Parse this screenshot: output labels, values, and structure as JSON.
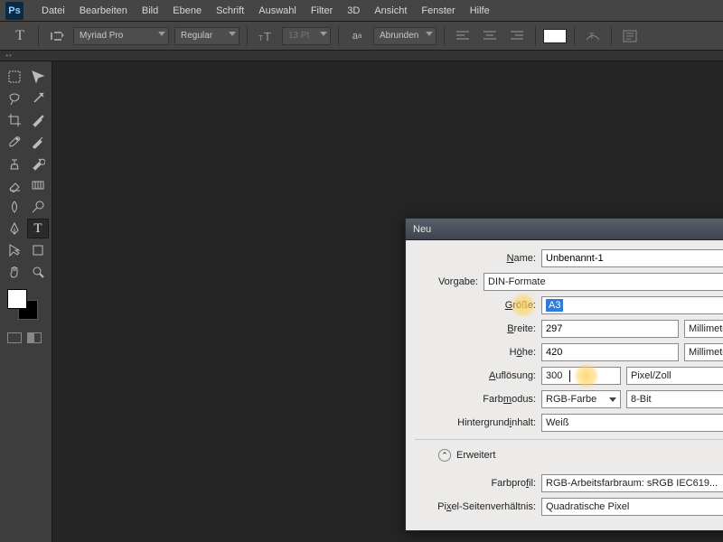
{
  "app": {
    "logo": "Ps"
  },
  "menu": [
    "Datei",
    "Bearbeiten",
    "Bild",
    "Ebene",
    "Schrift",
    "Auswahl",
    "Filter",
    "3D",
    "Ansicht",
    "Fenster",
    "Hilfe"
  ],
  "options": {
    "font": "Myriad Pro",
    "style": "Regular",
    "size": "13 Pt",
    "aa": "Abrunden"
  },
  "dialog": {
    "title": "Neu",
    "labels": {
      "name": "Name:",
      "preset": "Vorgabe:",
      "size": "Größe:",
      "width": "Breite:",
      "height": "Höhe:",
      "resolution": "Auflösung:",
      "colormode": "Farbmodus:",
      "bgcontent": "Hintergrundinhalt:",
      "advanced": "Erweitert",
      "profile": "Farbprofil:",
      "aspect": "Pixel-Seitenverhältnis:"
    },
    "values": {
      "name": "Unbenannt-1",
      "preset": "DIN-Formate",
      "size": "A3",
      "width": "297",
      "width_unit": "Millimeter",
      "height": "420",
      "height_unit": "Millimeter",
      "resolution": "300",
      "resolution_unit": "Pixel/Zoll",
      "colormode": "RGB-Farbe",
      "bitdepth": "8-Bit",
      "bgcontent": "Weiß",
      "profile": "RGB-Arbeitsfarbraum: sRGB IEC619...",
      "aspect": "Quadratische Pixel"
    }
  }
}
